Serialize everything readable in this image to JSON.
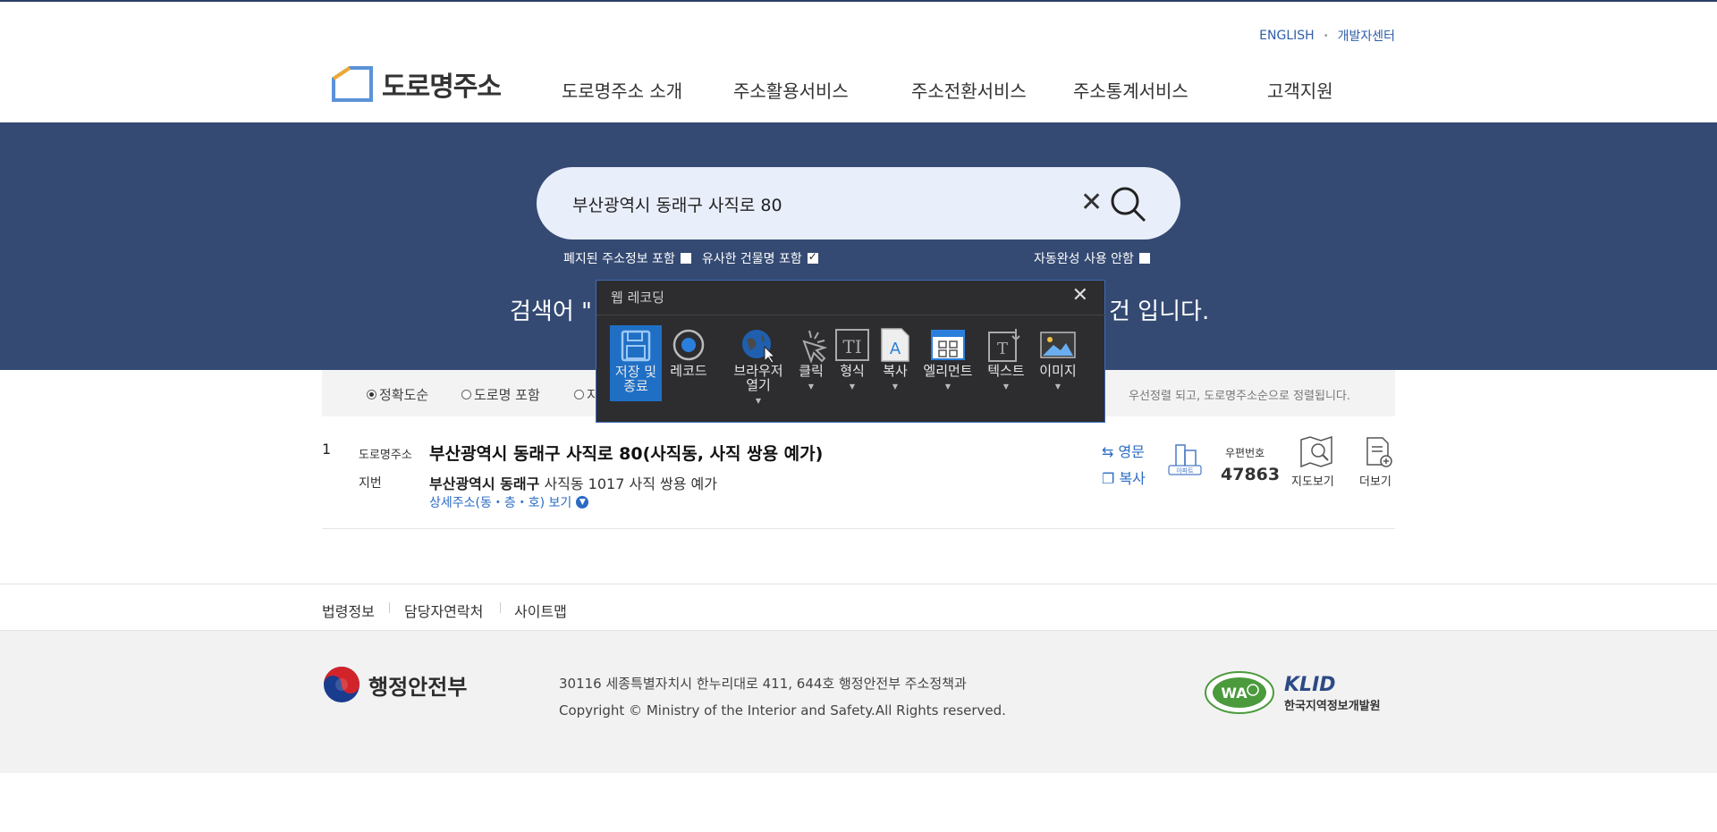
{
  "header": {
    "util_links": [
      "ENGLISH",
      "개발자센터"
    ],
    "logo_text": "도로명주소",
    "nav": [
      "도로명주소 소개",
      "주소활용서비스",
      "주소전환서비스",
      "주소통계서비스",
      "고객지원"
    ]
  },
  "search": {
    "query": "부산광역시 동래구 사직로 80",
    "opt_abolished": "폐지된 주소정보 포함",
    "opt_similar": "유사한 건물명 포함",
    "opt_autocomplete": "자동완성 사용 안함",
    "result_msg_left": "검색어 \"",
    "result_msg_right": "건 입니다."
  },
  "sort": {
    "options": [
      "정확도순",
      "도로명 포함",
      "지"
    ],
    "note": "우선정렬 되고, 도로명주소순으로 정렬됩니다."
  },
  "result": {
    "num": "1",
    "road_label": "도로명주소",
    "road_address": "부산광역시 동래구 사직로 80(사직동, 사직 쌍용 예가)",
    "jibun_label": "지번",
    "jibun_bold": "부산광역시 동래구",
    "jibun_rest": "사직동 1017 사직 쌍용 예가",
    "detail_link": "상세주소(동・층・호) 보기",
    "eng_btn": "영문",
    "copy_btn": "복사",
    "apt_badge": "아파트",
    "zip_label": "우편번호",
    "zip_code": "47863",
    "map_btn": "지도보기",
    "more_btn": "더보기"
  },
  "footer": {
    "links": [
      "법령정보",
      "담당자연락처",
      "사이트맵"
    ],
    "ministry": "행정안전부",
    "address": "30116 세종특별자치시 한누리대로 411, 644호 행정안전부 주소정책과",
    "copyright": "Copyright © Ministry of the Interior and Safety.All Rights reserved.",
    "klid_logo": "KLID",
    "klid_name": "한국지역정보개발원",
    "wa_mark": "WA"
  },
  "recorder": {
    "title": "웹 레코딩",
    "tools": [
      {
        "label": "저장 및\n종료",
        "icon": "save-icon"
      },
      {
        "label": "레코드",
        "icon": "record-icon"
      },
      {
        "label": "브라우저\n열기",
        "icon": "globe-icon"
      },
      {
        "label": "클릭",
        "icon": "click-icon"
      },
      {
        "label": "형식",
        "icon": "type-icon"
      },
      {
        "label": "복사",
        "icon": "copy-icon"
      },
      {
        "label": "엘리먼트",
        "icon": "element-icon"
      },
      {
        "label": "텍스트",
        "icon": "text-icon"
      },
      {
        "label": "이미지",
        "icon": "image-icon"
      }
    ]
  },
  "colors": {
    "band": "#344a73",
    "accent": "#2a6bc4",
    "recorder_bg": "#2d2d30",
    "recorder_active": "#1f6fc5"
  }
}
